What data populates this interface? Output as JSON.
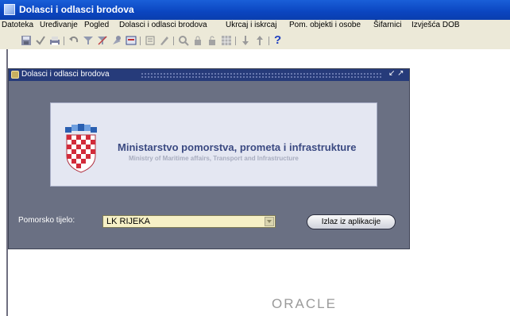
{
  "app": {
    "title": "Dolasci i odlasci brodova"
  },
  "menu": [
    "Datoteka",
    "Uređivanje",
    "Pogled",
    "Dolasci i odlasci brodova",
    "Ukrcaj i iskrcaj",
    "Pom. objekti i osobe",
    "Šifarnici",
    "Izvješća DOB"
  ],
  "toolbar": {
    "icons": [
      "save-icon",
      "check-icon",
      "print-icon",
      "undo-icon",
      "filter-icon",
      "cancel-filter-icon",
      "pin-icon",
      "form-icon",
      "list-icon",
      "edit-icon",
      "search-icon",
      "lock-icon",
      "unlock-icon",
      "grid-icon",
      "down-arrow-icon",
      "up-arrow-icon"
    ],
    "help_label": "?"
  },
  "inner_window": {
    "title": "Dolasci i odlasci brodova",
    "controls": "↙ ↗"
  },
  "banner": {
    "ministry": "Ministarstvo pomorstva, prometa i infrastrukture",
    "ministry_en": "Ministry of Maritime affairs, Transport and Infrastructure"
  },
  "form": {
    "pomorsko_label": "Pomorsko tijelo:",
    "pomorsko_value": "LK RIJEKA",
    "exit_label": "Izlaz iz aplikacije"
  },
  "footer": {
    "brand": "ORACLE"
  },
  "colors": {
    "titlebar": "#0b45c0",
    "menubar": "#ece9d8",
    "inner_window": "#6a7083",
    "inner_title": "#263b7a",
    "combo_bg": "#f6f0c6",
    "banner_bg": "#e4e7f2"
  }
}
